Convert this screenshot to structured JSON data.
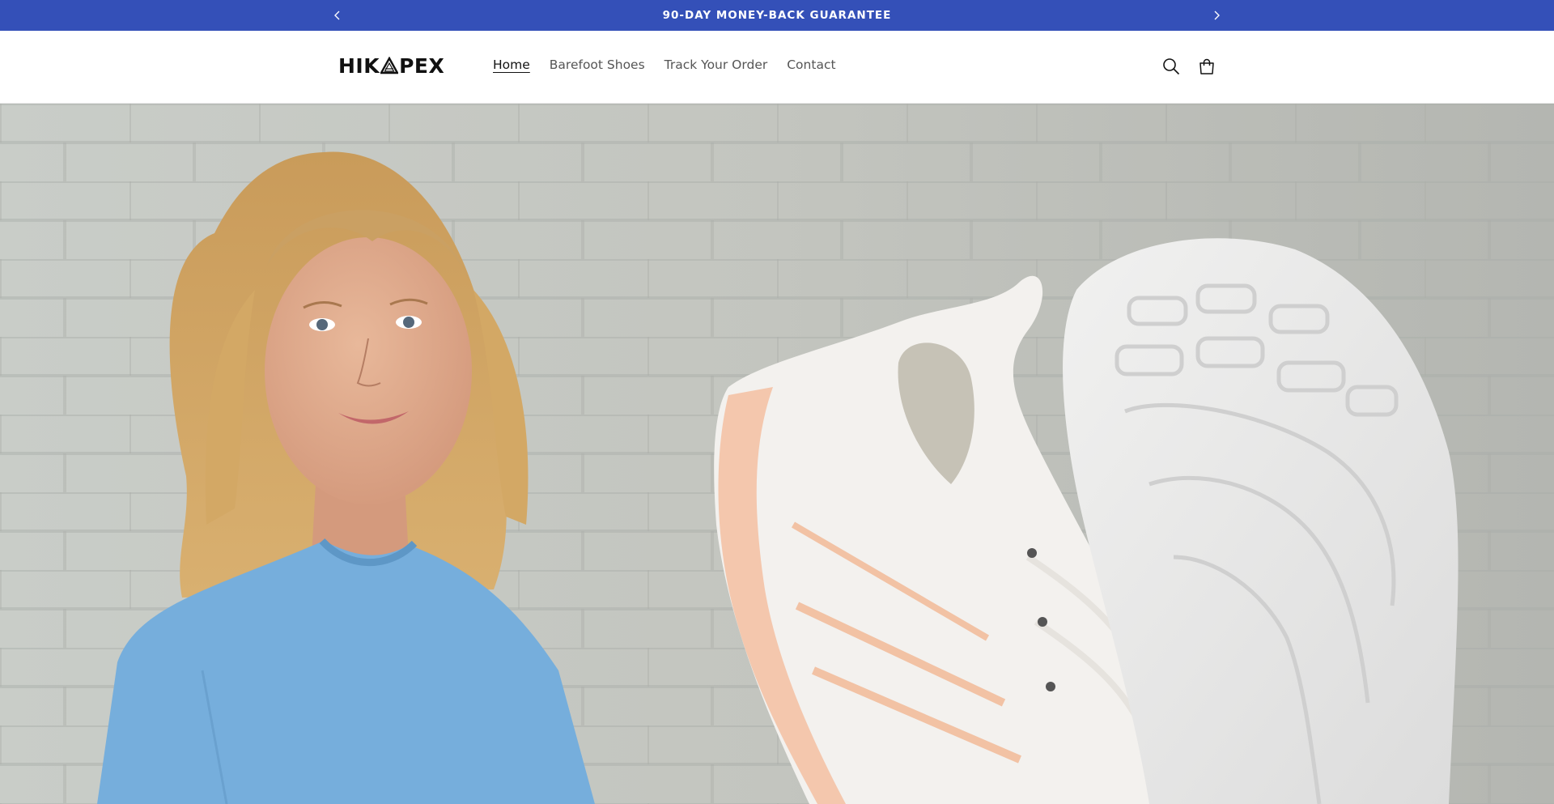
{
  "announcement": {
    "message": "90-DAY MONEY-BACK GUARANTEE",
    "prev_icon": "chevron-left-icon",
    "next_icon": "chevron-right-icon"
  },
  "header": {
    "logo_text_left": "HIK",
    "logo_text_right": "PEX",
    "nav": [
      {
        "label": "Home",
        "active": true
      },
      {
        "label": "Barefoot Shoes",
        "active": false
      },
      {
        "label": "Track Your Order",
        "active": false
      },
      {
        "label": "Contact",
        "active": false
      }
    ],
    "icons": [
      "search-icon",
      "cart-icon"
    ]
  },
  "colors": {
    "announcement_bg": "#3450b8",
    "text": "#121212",
    "nav_text": "#555555"
  },
  "hero": {
    "image": "woman-with-barefoot-shoes-photo"
  }
}
